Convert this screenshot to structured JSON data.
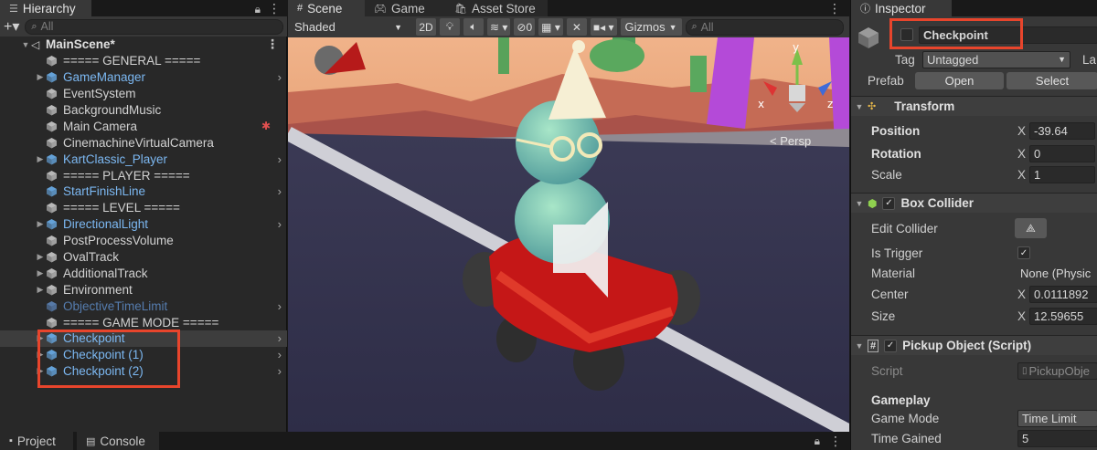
{
  "hierarchy": {
    "tab_label": "Hierarchy",
    "search_placeholder": "All",
    "scene_name": "MainScene*",
    "items": [
      {
        "label": "===== GENERAL =====",
        "type": "plain",
        "arrow": false,
        "chevron": false
      },
      {
        "label": "GameManager",
        "type": "prefab",
        "arrow": true,
        "chevron": true
      },
      {
        "label": "EventSystem",
        "type": "plain",
        "arrow": false,
        "chevron": false
      },
      {
        "label": "BackgroundMusic",
        "type": "plain",
        "arrow": false,
        "chevron": false
      },
      {
        "label": "Main Camera",
        "type": "plain",
        "arrow": false,
        "chevron": false,
        "bug": true
      },
      {
        "label": "CinemachineVirtualCamera",
        "type": "plain",
        "arrow": false,
        "chevron": false
      },
      {
        "label": "KartClassic_Player",
        "type": "prefab",
        "arrow": true,
        "chevron": true
      },
      {
        "label": "===== PLAYER =====",
        "type": "plain",
        "arrow": false,
        "chevron": false
      },
      {
        "label": "StartFinishLine",
        "type": "prefab",
        "arrow": false,
        "chevron": true
      },
      {
        "label": "===== LEVEL =====",
        "type": "plain",
        "arrow": false,
        "chevron": false
      },
      {
        "label": "DirectionalLight",
        "type": "prefab",
        "arrow": true,
        "chevron": true
      },
      {
        "label": "PostProcessVolume",
        "type": "plain",
        "arrow": false,
        "chevron": false
      },
      {
        "label": "OvalTrack",
        "type": "plain",
        "arrow": true,
        "chevron": false
      },
      {
        "label": "AdditionalTrack",
        "type": "plain",
        "arrow": true,
        "chevron": false
      },
      {
        "label": "Environment",
        "type": "plain",
        "arrow": true,
        "chevron": false
      },
      {
        "label": "ObjectiveTimeLimit",
        "type": "prefab-dim",
        "arrow": false,
        "chevron": true
      },
      {
        "label": "===== GAME MODE =====",
        "type": "plain",
        "arrow": false,
        "chevron": false
      },
      {
        "label": "Checkpoint",
        "type": "prefab",
        "arrow": true,
        "chevron": true,
        "selected": true
      },
      {
        "label": "Checkpoint (1)",
        "type": "prefab",
        "arrow": true,
        "chevron": true
      },
      {
        "label": "Checkpoint (2)",
        "type": "prefab",
        "arrow": true,
        "chevron": true
      }
    ]
  },
  "scene": {
    "tabs": [
      {
        "label": "Scene",
        "active": true
      },
      {
        "label": "Game",
        "active": false
      },
      {
        "label": "Asset Store",
        "active": false
      }
    ],
    "shading_mode": "Shaded",
    "btn_2d": "2D",
    "hidden_count": "0",
    "gizmos_label": "Gizmos",
    "search_placeholder": "All",
    "gizmo_axes": {
      "y": "y",
      "x": "x",
      "z": "z"
    },
    "projection_label": "Persp"
  },
  "inspector": {
    "tab_label": "Inspector",
    "object_name": "Checkpoint",
    "tag_label": "Tag",
    "tag_value": "Untagged",
    "layer_label": "La",
    "prefab_label": "Prefab",
    "prefab_open": "Open",
    "prefab_select": "Select",
    "transform": {
      "title": "Transform",
      "position_label": "Position",
      "rotation_label": "Rotation",
      "scale_label": "Scale",
      "axis": "X",
      "position_x": "-39.64",
      "rotation_x": "0",
      "scale_x": "1"
    },
    "box_collider": {
      "title": "Box Collider",
      "edit_collider_label": "Edit Collider",
      "is_trigger_label": "Is Trigger",
      "is_trigger_checked": true,
      "material_label": "Material",
      "material_value": "None (Physic",
      "center_label": "Center",
      "center_x": "0.0111892",
      "size_label": "Size",
      "size_x": "12.59655",
      "axis": "X"
    },
    "pickup_object": {
      "title": "Pickup Object (Script)",
      "script_label": "Script",
      "script_value": "PickupObje",
      "gameplay_header": "Gameplay",
      "game_mode_label": "Game Mode",
      "game_mode_value": "Time Limit",
      "time_gained_label": "Time Gained",
      "time_gained_value": "5"
    }
  },
  "bottom_tabs": [
    {
      "label": "Project"
    },
    {
      "label": "Console"
    }
  ],
  "colors": {
    "highlight": "#e8452c",
    "prefab_text": "#7cb8f2",
    "panel_bg": "#282828",
    "inspector_bg": "#383838"
  }
}
